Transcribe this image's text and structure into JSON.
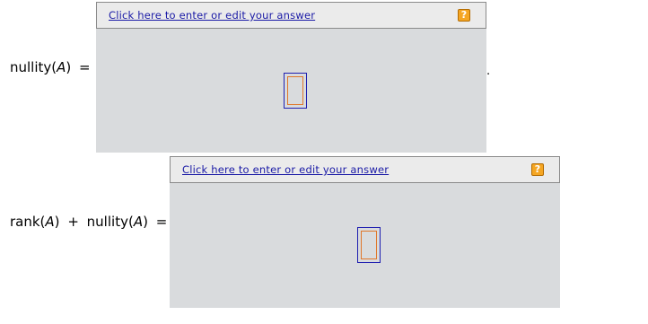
{
  "question_1": {
    "label_func": "nullity(",
    "label_var": "A",
    "label_close": ")",
    "label_eq": "=",
    "edit_link": "Click here to enter or edit your answer",
    "help_icon": "?",
    "trailing": "."
  },
  "question_2": {
    "label_func1": "rank(",
    "label_var1": "A",
    "label_close1": ")",
    "label_plus": "+",
    "label_func2": "nullity(",
    "label_var2": "A",
    "label_close2": ")",
    "label_eq": "=",
    "edit_link": "Click here to enter or edit your answer",
    "help_icon": "?"
  },
  "colors": {
    "panel_bg": "#d9dbdd",
    "header_bg": "#ebebeb",
    "link": "#1a1aa6",
    "help_icon": "#f5a623",
    "placeholder_outer": "#1f1fb0",
    "placeholder_inner": "#e0772a"
  }
}
